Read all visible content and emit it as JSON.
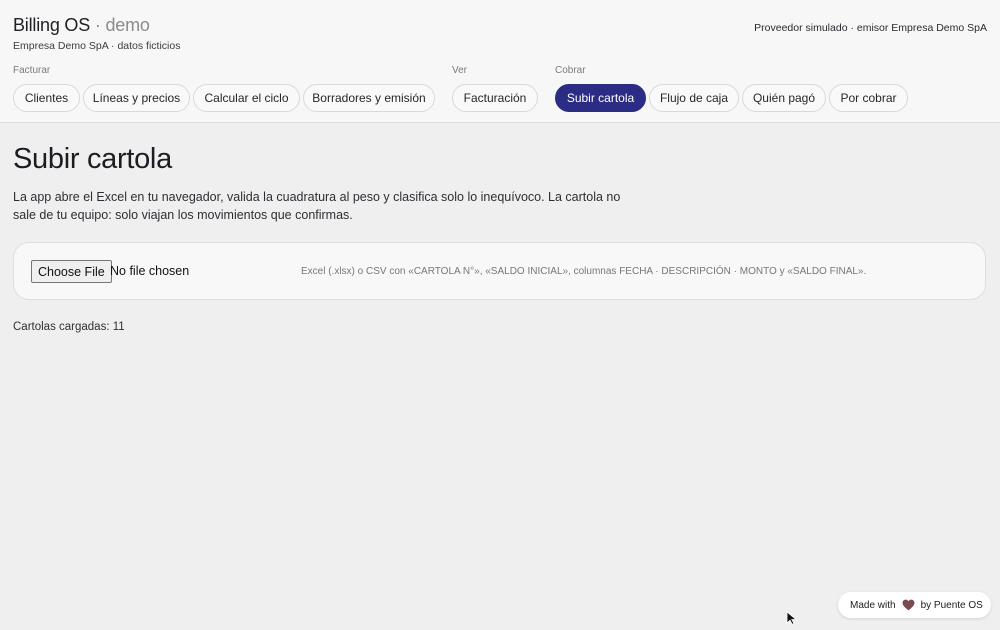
{
  "header": {
    "brand": "Billing OS",
    "brand_sep": "·",
    "brand_suffix": "demo",
    "company": "Empresa Demo SpA · datos ficticios",
    "provider": "Proveedor simulado · emisor Empresa Demo SpA"
  },
  "nav": {
    "groups": [
      {
        "label": "Facturar",
        "items": [
          "Clientes",
          "Líneas y precios",
          "Calcular el ciclo",
          "Borradores y emisión"
        ]
      },
      {
        "label": "Ver",
        "items": [
          "Facturación"
        ]
      },
      {
        "label": "Cobrar",
        "items": [
          "Subir cartola",
          "Flujo de caja",
          "Quién pagó",
          "Por cobrar"
        ]
      }
    ],
    "active": "Subir cartola",
    "accent_color": "#2b2c83"
  },
  "main": {
    "title": "Subir cartola",
    "description": "La app abre el Excel en tu navegador, valida la cuadratura al peso y clasifica solo lo inequívoco. La cartola no sale de tu equipo: solo viajan los movimientos que confirmas.",
    "upload": {
      "button_label": "Choose File",
      "status": "No file chosen",
      "hint": "Excel (.xlsx) o CSV con «CARTOLA N°», «SALDO INICIAL», columnas FECHA · DESCRIPCIÓN · MONTO y «SALDO FINAL»."
    },
    "count_label": "Cartolas cargadas: 11"
  },
  "badge": {
    "prefix": "Made with",
    "suffix": "by Puente OS",
    "icon": "heart-icon"
  }
}
